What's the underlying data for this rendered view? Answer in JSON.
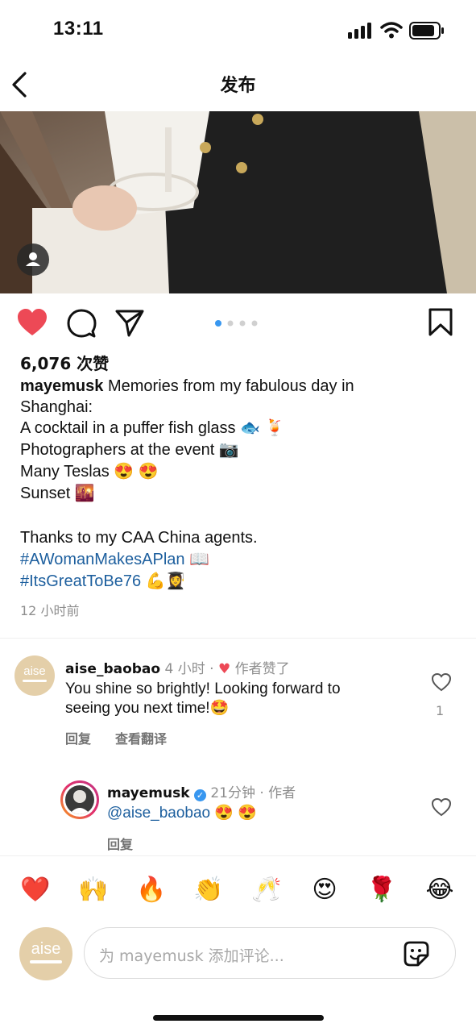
{
  "status_bar": {
    "time": "13:11"
  },
  "header": {
    "title": "发布"
  },
  "post": {
    "likes": "6,076 次赞",
    "caption_username": "mayemusk",
    "caption_lines": [
      "Memories from my fabulous day in",
      "Shanghai:",
      "A cocktail in a puffer fish glass 🐟 🍹",
      "Photographers at the event 📷",
      "Many Teslas 😍 😍",
      "Sunset 🌇",
      "",
      "Thanks to my CAA China agents."
    ],
    "hashtags": [
      "#AWomanMakesAPlan 📖",
      "#ItsGreatToBe76 💪👩‍🎓"
    ],
    "time": "12 小时前"
  },
  "comments": [
    {
      "username": "aise_baobao",
      "avatar_text": "aise",
      "meta": "4 小时",
      "author_liked": "作者赞了",
      "lines": [
        "You shine so brightly! Looking forward to",
        "seeing you next time!🤩"
      ],
      "like_count": "1",
      "reply_label": "回复",
      "translate_label": "查看翻译"
    },
    {
      "username": "mayemusk",
      "meta": "21分钟 · 作者",
      "mention": "@aise_baobao",
      "text": "😍 😍",
      "reply_label": "回复"
    }
  ],
  "reactions": [
    "❤️",
    "🙌",
    "🔥",
    "👏",
    "🥂",
    "😍",
    "🌹",
    "😂"
  ],
  "composer": {
    "avatar_text": "aise",
    "placeholder": "为 mayemusk 添加评论..."
  },
  "colors": {
    "like_red": "#ed4956",
    "hashtag_blue": "#1d5f9e",
    "dot_active": "#3897f0",
    "aise_gold": "#d9b98a"
  }
}
